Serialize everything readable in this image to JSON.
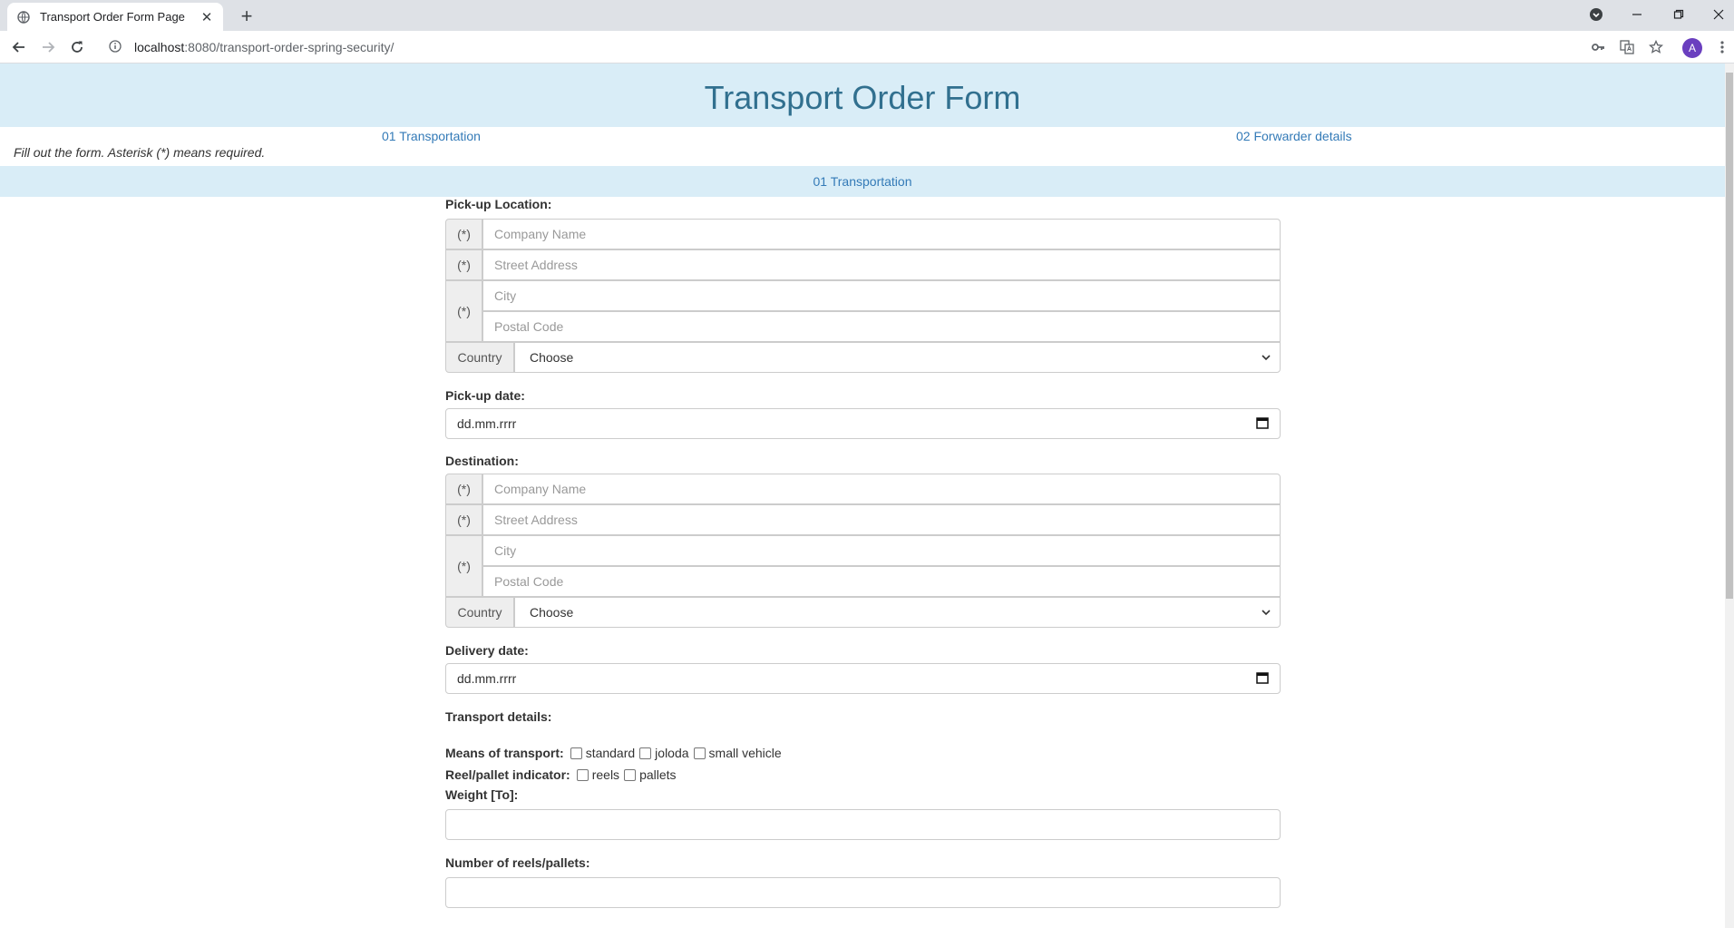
{
  "browser": {
    "tab_title": "Transport Order Form Page",
    "url_host": "localhost",
    "url_rest": ":8080/transport-order-spring-security/",
    "avatar_letter": "A"
  },
  "page": {
    "title": "Transport Order Form",
    "steps": [
      "01 Transportation",
      "02 Forwarder details"
    ],
    "note": "Fill out the form. Asterisk (*) means required.",
    "section": "01 Transportation"
  },
  "form": {
    "required_marker": "(*)",
    "pickup": {
      "label": "Pick-up Location:",
      "company_placeholder": "Company Name",
      "street_placeholder": "Street Address",
      "city_placeholder": "City",
      "postal_placeholder": "Postal Code",
      "country_label": "Country",
      "country_value": "Choose"
    },
    "pickup_date": {
      "label": "Pick-up date:",
      "placeholder": "dd.mm.rrrr"
    },
    "destination": {
      "label": "Destination:",
      "company_placeholder": "Company Name",
      "street_placeholder": "Street Address",
      "city_placeholder": "City",
      "postal_placeholder": "Postal Code",
      "country_label": "Country",
      "country_value": "Choose"
    },
    "delivery_date": {
      "label": "Delivery date:",
      "placeholder": "dd.mm.rrrr"
    },
    "transport_details_label": "Transport details:",
    "means": {
      "label": "Means of transport:",
      "options": [
        "standard",
        "joloda",
        "small vehicle"
      ]
    },
    "reel_pallet": {
      "label": "Reel/pallet indicator:",
      "options": [
        "reels",
        "pallets"
      ]
    },
    "weight": {
      "label": "Weight [To]:"
    },
    "count": {
      "label": "Number of reels/pallets:"
    }
  }
}
